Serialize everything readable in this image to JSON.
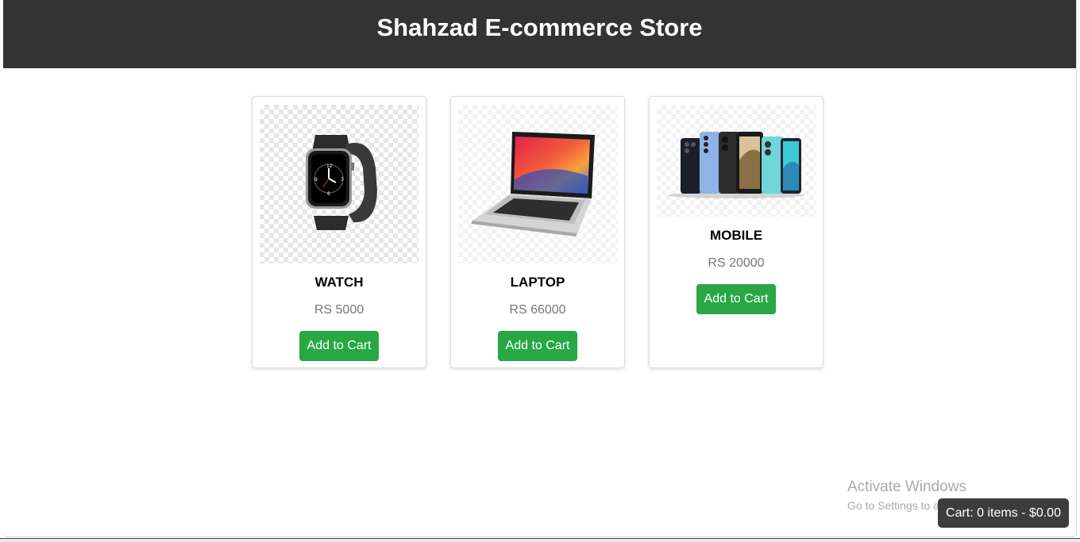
{
  "header": {
    "title": "Shahzad E-commerce Store"
  },
  "products": [
    {
      "name": "WATCH",
      "price": "RS 5000",
      "button_label": "Add to Cart",
      "icon": "smartwatch-image"
    },
    {
      "name": "LAPTOP",
      "price": "RS 66000",
      "button_label": "Add to Cart",
      "icon": "laptop-image"
    },
    {
      "name": "MOBILE",
      "price": "RS 20000",
      "button_label": "Add to Cart",
      "icon": "mobile-phones-image"
    }
  ],
  "cart": {
    "summary": "Cart: 0 items - $0.00"
  },
  "watermark": {
    "line1": "Activate Windows",
    "line2": "Go to Settings to activate Windows."
  },
  "colors": {
    "header_bg": "#333333",
    "button_green": "#28a745",
    "price_gray": "#777777"
  }
}
